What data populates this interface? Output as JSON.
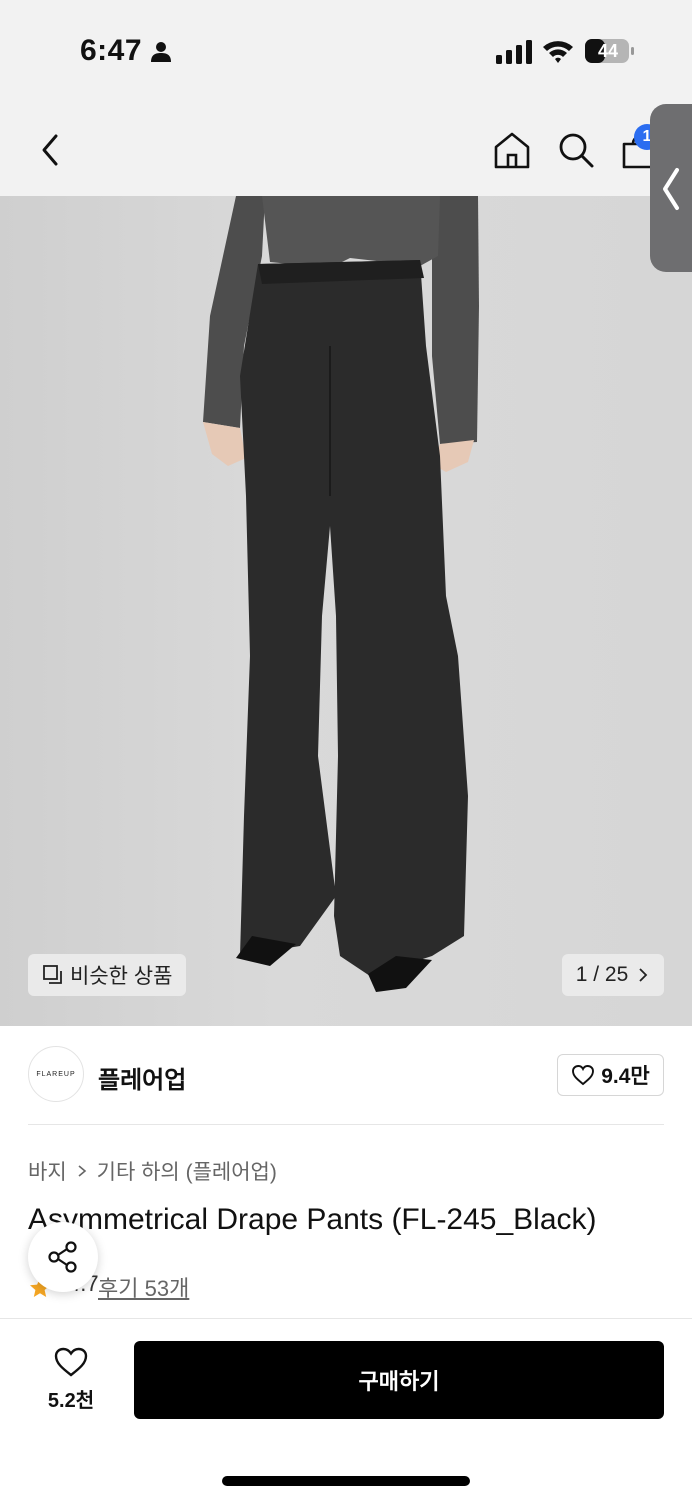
{
  "status_bar": {
    "time": "6:47",
    "battery": "44"
  },
  "nav": {
    "cart_badge": "1"
  },
  "hero": {
    "similar_label": "비슷한 상품",
    "page_counter": "1 / 25"
  },
  "brand": {
    "logo_text": "FLAREUP",
    "name": "플레어업",
    "like_count": "9.4만"
  },
  "product": {
    "breadcrumb": [
      "바지",
      "기타 하의 (플레어업)"
    ],
    "title": "Asymmetrical Drape Pants (FL-245_Black)",
    "rating": "4.7",
    "review_link": "후기 53개"
  },
  "bottom_bar": {
    "wish_count": "5.2천",
    "buy_label": "구매하기"
  },
  "colors": {
    "accent_badge": "#2b6df0",
    "buy_button": "#000000",
    "star": "#f5a623"
  }
}
